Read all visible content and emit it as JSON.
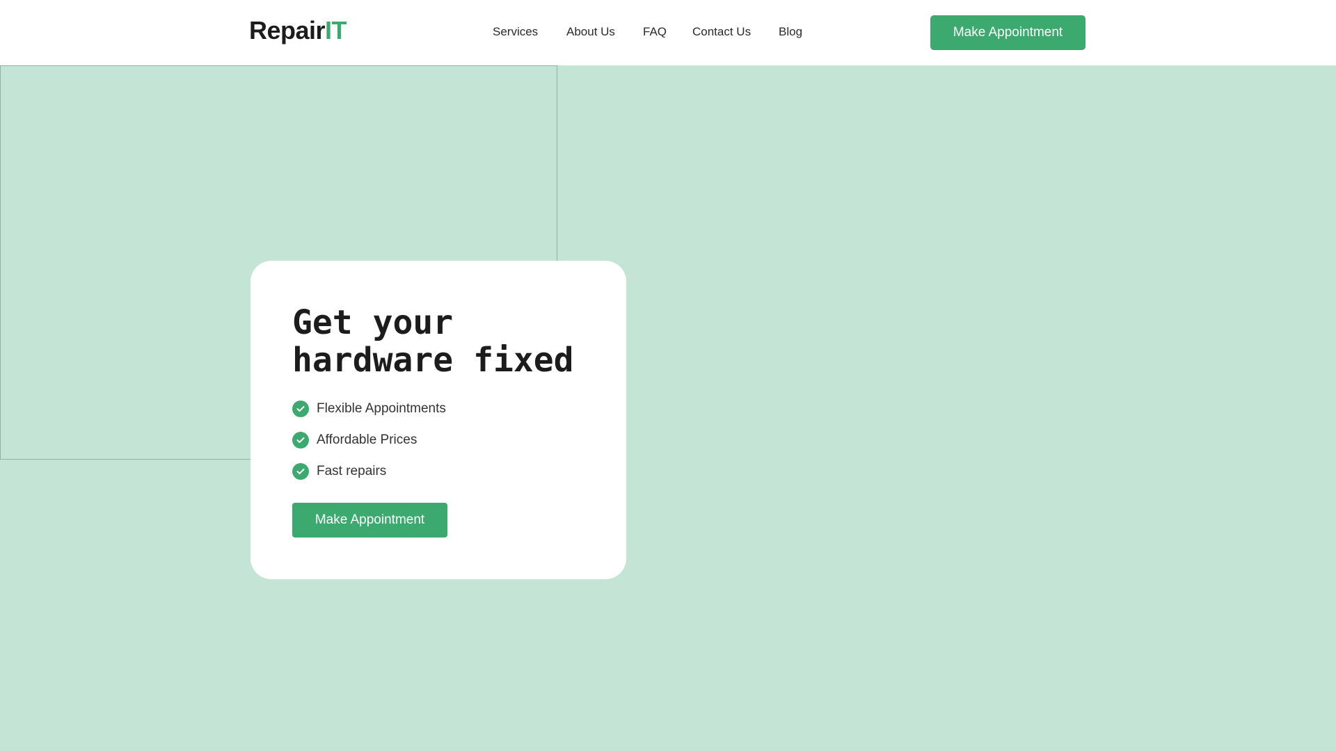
{
  "header": {
    "logo_main": "Repair",
    "logo_accent": "IT",
    "nav": [
      "Services",
      "About Us",
      "FAQ",
      "Contact Us",
      "Blog"
    ],
    "cta_label": "Make Appointment"
  },
  "hero": {
    "title_line1": "Get your",
    "title_line2": "hardware fixed",
    "features": [
      "Flexible Appointments",
      "Affordable Prices",
      "Fast repairs"
    ],
    "cta_label": "Make Appointment"
  },
  "colors": {
    "accent": "#3caa6e",
    "background": "#c4e5d5"
  }
}
